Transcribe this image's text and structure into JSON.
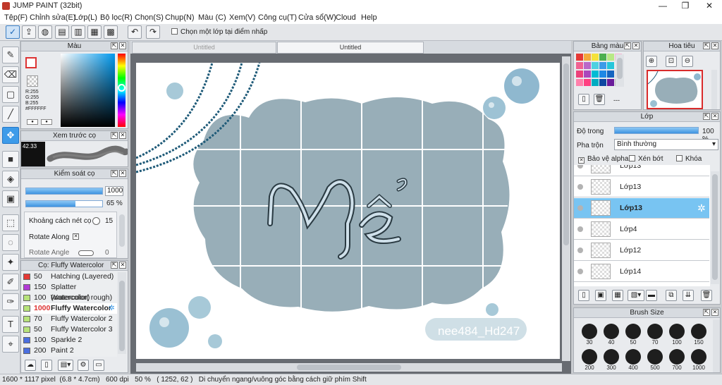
{
  "window": {
    "title": "JUMP PAINT (32bit)",
    "minimize": "—",
    "maximize": "❐",
    "close": "✕"
  },
  "menu": [
    "Tệp(F)",
    "Chỉnh sửa(E)",
    "Lớp(L)",
    "Bộ lọc(R)",
    "Chọn(S)",
    "Chụp(N)",
    "Màu (C)",
    "Xem(V)",
    "Công cụ(T)",
    "Cửa sổ(W)",
    "Cloud",
    "Help"
  ],
  "toolbar": {
    "select_layer_checkbox": "Chọn một lớp tại điểm nhấp"
  },
  "color_panel": {
    "title": "Màu",
    "r": "R:255",
    "g": "G:255",
    "b": "B:255",
    "hex": "#FFFFFF"
  },
  "preview_panel": {
    "title": "Xem trước cọ",
    "size": "42.33"
  },
  "brush_control": {
    "title": "Kiểm soát cọ",
    "size_value": "1000",
    "size_fill": 1.0,
    "opacity_value": "65 %",
    "opacity_fill": 0.65,
    "spacing_label": "Khoảng cách nét cọ",
    "spacing_value": "15",
    "rotate_along": "Rotate Along",
    "rotate_angle": "Rotate Angle",
    "rotate_angle_value": "0"
  },
  "brush_list": {
    "title": "Cọ: Fluffy Watercolor",
    "items": [
      {
        "size": "50",
        "name": "Hatching (Layered)",
        "color": "#e53935"
      },
      {
        "size": "150",
        "name": "Splatter (watercolor)",
        "color": "#b23ad6"
      },
      {
        "size": "100",
        "name": "Watercolor( rough)",
        "color": "#b7e37a"
      },
      {
        "size": "1000",
        "name": "Fluffy Watercolor",
        "color": "#b7e37a"
      },
      {
        "size": "70",
        "name": "Fluffy Watercolor 2",
        "color": "#b7e37a"
      },
      {
        "size": "50",
        "name": "Fluffy Watercolor 3",
        "color": "#b7e37a"
      },
      {
        "size": "100",
        "name": "Sparkle 2",
        "color": "#4a6fe0"
      },
      {
        "size": "200",
        "name": "Paint 2",
        "color": "#4a6fe0"
      }
    ]
  },
  "tabs": [
    "Untitled",
    "Untitled"
  ],
  "canvas": {
    "text": "nee484_Hd247"
  },
  "swatch_panel": {
    "title": "Bảng màu",
    "more": "---"
  },
  "navigator_panel": {
    "title": "Hoa tiêu"
  },
  "layer_panel": {
    "title": "Lớp",
    "opacity_label": "Độ trong",
    "opacity_value": "100 %",
    "opacity_fill": 1.0,
    "blend_label": "Pha trộn",
    "blend_value": "Bình thường",
    "protect_alpha": "Bảo vệ alpha",
    "clipping": "Xén bớt",
    "lock": "Khóa",
    "layers": [
      "Lớp13",
      "Lớp13",
      "Lớp13",
      "Lớp4",
      "Lớp12",
      "Lớp14"
    ]
  },
  "brush_size_panel": {
    "title": "Brush Size",
    "sizes": [
      "30",
      "40",
      "50",
      "70",
      "100",
      "150",
      "200",
      "300",
      "400",
      "500",
      "700",
      "1000"
    ]
  },
  "status": {
    "size": "1600 * 1117 pixel",
    "dims": "(6.8 * 4.7cm)",
    "dpi": "600 dpi",
    "zoom": "50 %",
    "coords": "( 1252, 62 )",
    "hint": "Di chuyển ngang/vuông góc bằng cách giữ phím Shift"
  },
  "colors": {
    "accent": "#3d9be9",
    "selected_layer": "#78c4f2",
    "canvas_blob": "#98aeb8"
  }
}
